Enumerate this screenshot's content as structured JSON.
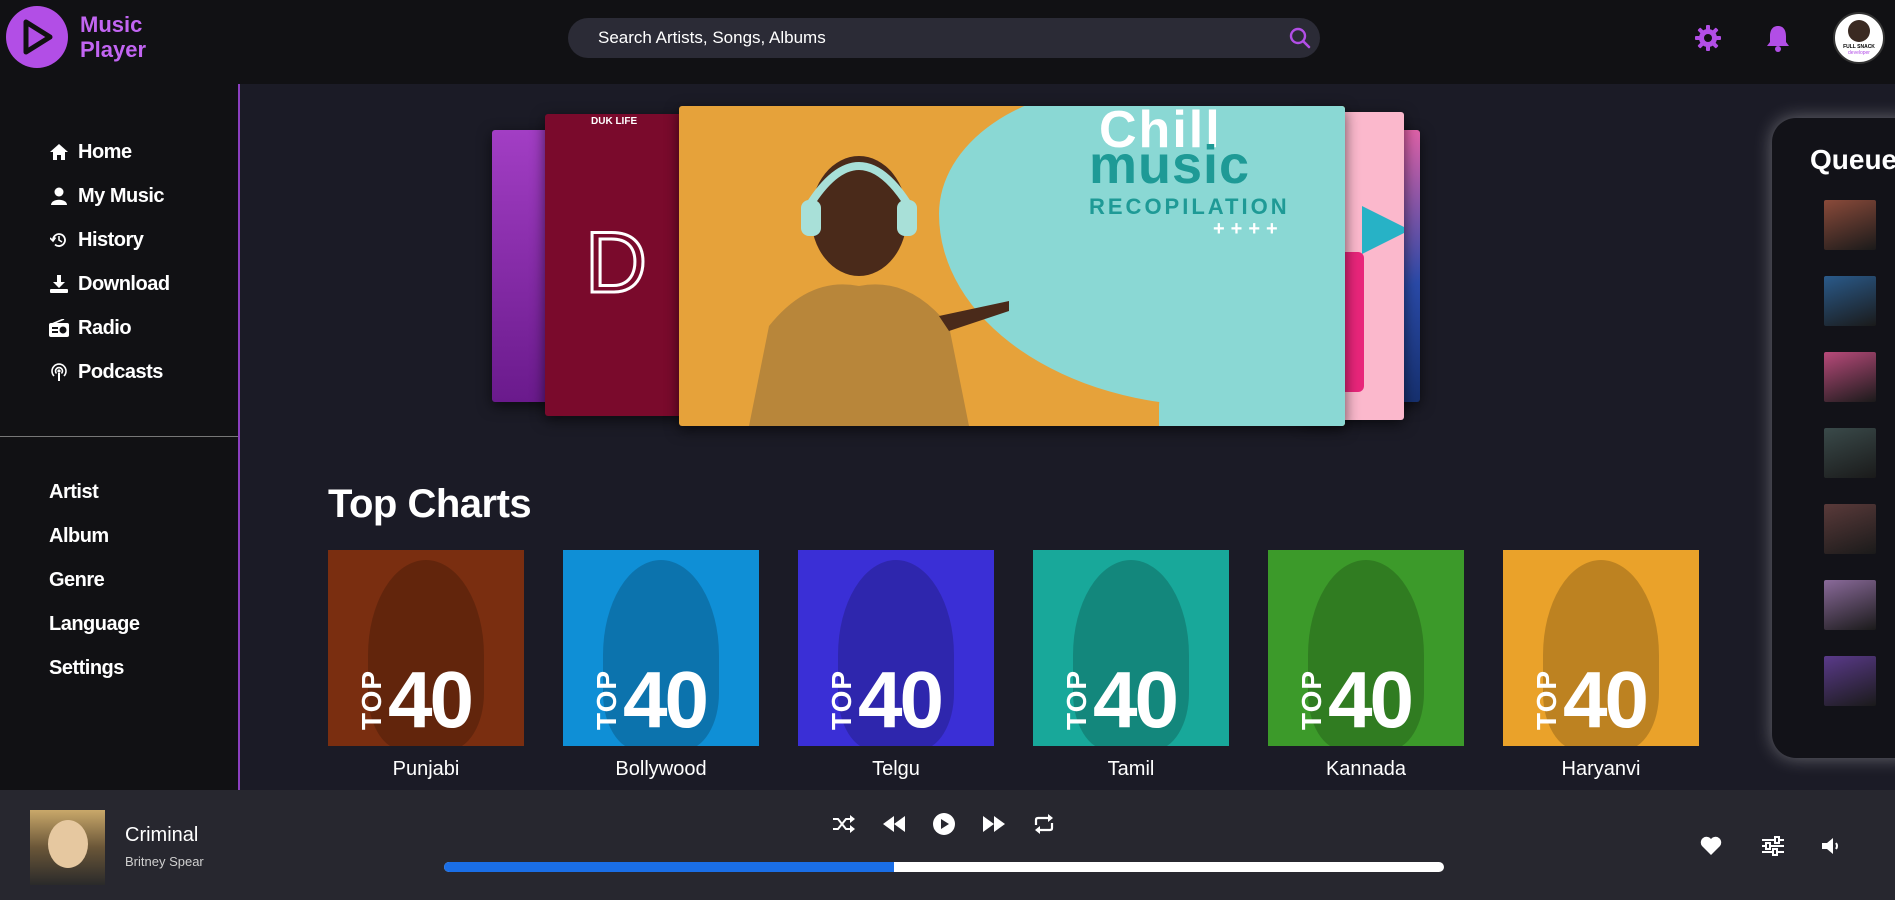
{
  "app": {
    "logo_line1": "Music",
    "logo_line2": "Player"
  },
  "search": {
    "placeholder": "Search Artists, Songs, Albums"
  },
  "avatar": {
    "line1": "FULL SNACK",
    "line2": "developer"
  },
  "sidebar": {
    "main_items": [
      {
        "label": "Home",
        "icon": "home-icon"
      },
      {
        "label": "My Music",
        "icon": "user-icon"
      },
      {
        "label": "History",
        "icon": "history-icon"
      },
      {
        "label": "Download",
        "icon": "download-icon"
      },
      {
        "label": "Radio",
        "icon": "radio-icon"
      },
      {
        "label": "Podcasts",
        "icon": "podcast-icon"
      }
    ],
    "browse_items": [
      {
        "label": "Artist"
      },
      {
        "label": "Album"
      },
      {
        "label": "Genre"
      },
      {
        "label": "Language"
      },
      {
        "label": "Settings"
      }
    ]
  },
  "carousel": {
    "side_card_title": "DUK LIFE",
    "side_card_letter": "D",
    "featured": {
      "line1": "Chill",
      "line2": "music",
      "line3": "RECOPILATION",
      "line4": "++++"
    }
  },
  "top_charts": {
    "title": "Top Charts",
    "items": [
      {
        "label": "Punjabi",
        "top": "TOP",
        "number": "40",
        "color": "#7a2e10"
      },
      {
        "label": "Bollywood",
        "top": "TOP",
        "number": "40",
        "color": "#0f8fd6"
      },
      {
        "label": "Telgu",
        "top": "TOP",
        "number": "40",
        "color": "#3a2fd6"
      },
      {
        "label": "Tamil",
        "top": "TOP",
        "number": "40",
        "color": "#18a89a"
      },
      {
        "label": "Kannada",
        "top": "TOP",
        "number": "40",
        "color": "#3c9a2a"
      },
      {
        "label": "Haryanvi",
        "top": "TOP",
        "number": "40",
        "color": "#eaa22a"
      }
    ]
  },
  "queue": {
    "title": "Queue",
    "thumb_colors": [
      "#8a4a3a",
      "#2a5a8a",
      "#b84a7a",
      "#3a4a4a",
      "#5a3a3a",
      "#8a6a9a",
      "#5a3a8a"
    ]
  },
  "player": {
    "title": "Criminal",
    "artist": "Britney Spear",
    "progress_fraction": 0.45
  },
  "colors": {
    "accent": "#b24ee6",
    "progress": "#1a6ee6"
  }
}
